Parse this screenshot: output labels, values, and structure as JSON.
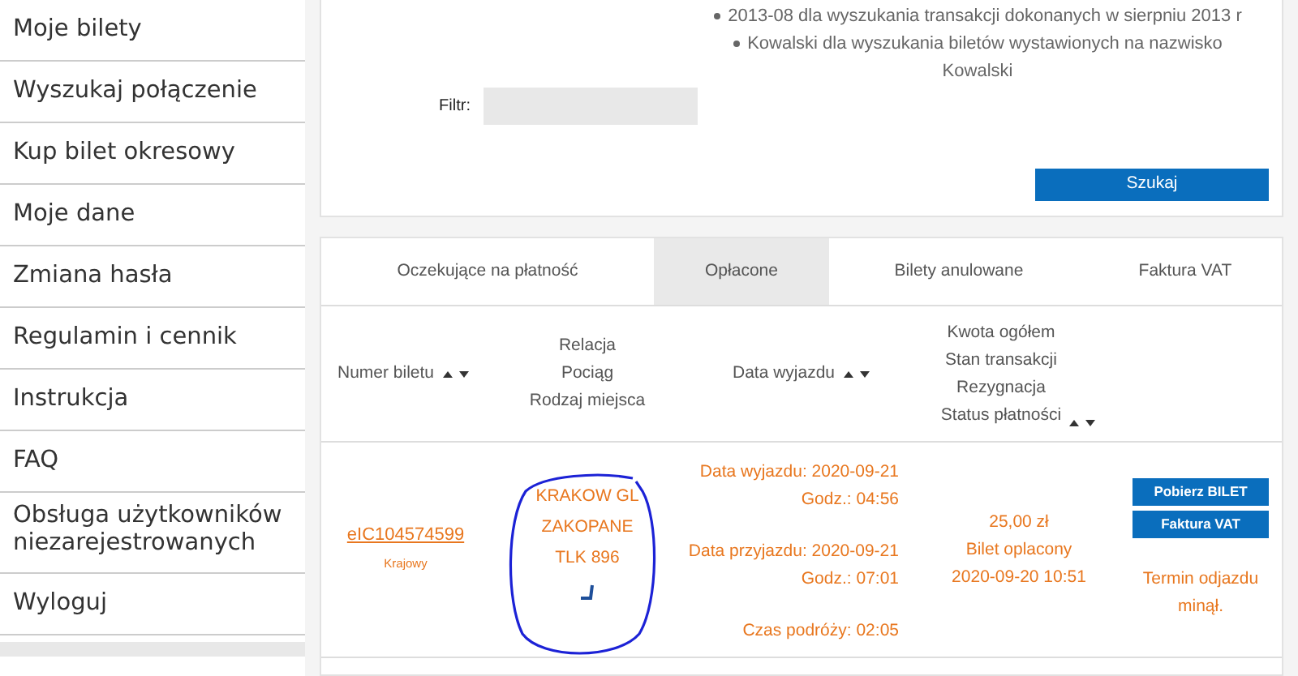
{
  "sidebar": {
    "items": [
      {
        "label": "Moje bilety"
      },
      {
        "label": "Wyszukaj połączenie"
      },
      {
        "label": "Kup bilet okresowy"
      },
      {
        "label": "Moje dane"
      },
      {
        "label": "Zmiana hasła"
      },
      {
        "label": "Regulamin i cennik"
      },
      {
        "label": "Instrukcja"
      },
      {
        "label": "FAQ"
      },
      {
        "label": "Obsługa użytkowników niezarejestrowanych"
      },
      {
        "label": "Wyloguj"
      }
    ]
  },
  "filter": {
    "label": "Filtr:",
    "hints": [
      "2013-08 dla wyszukania transakcji dokonanych w sierpniu 2013 r",
      "Kowalski dla wyszukania biletów wystawionych na nazwisko Kowalski"
    ],
    "search_button": "Szukaj"
  },
  "tabs": [
    {
      "label": "Oczekujące na płatność",
      "selected": false
    },
    {
      "label": "Opłacone",
      "selected": true
    },
    {
      "label": "Bilety anulowane",
      "selected": false
    },
    {
      "label": "Faktura VAT",
      "selected": false
    }
  ],
  "columns": [
    {
      "lines": [
        "Numer biletu"
      ],
      "sortable": true
    },
    {
      "lines": [
        "Relacja",
        "Pociąg",
        "Rodzaj miejsca"
      ],
      "sortable": false
    },
    {
      "lines": [
        "Data wyjazdu"
      ],
      "sortable": true
    },
    {
      "lines": [
        "Kwota ogółem",
        "Stan transakcji",
        "Rezygnacja",
        "Status płatności"
      ],
      "sortable": true
    }
  ],
  "tickets": [
    {
      "number": "eIC104574599",
      "type": "Krajowy",
      "route": [
        "KRAKOW GL",
        "ZAKOPANE",
        "TLK 896"
      ],
      "departure": "Data wyjazdu: 2020-09-21",
      "departure_time": "Godz.: 04:56",
      "arrival": "Data przyjazdu: 2020-09-21",
      "arrival_time": "Godz.: 07:01",
      "duration": "Czas podróży: 02:05",
      "amount": "25,00 zł",
      "status": "Bilet oplacony",
      "paid_at": "2020-09-20 10:51",
      "actions": [
        "Pobierz BILET",
        "Faktura VAT"
      ],
      "note": "Termin odjazdu minął."
    }
  ]
}
